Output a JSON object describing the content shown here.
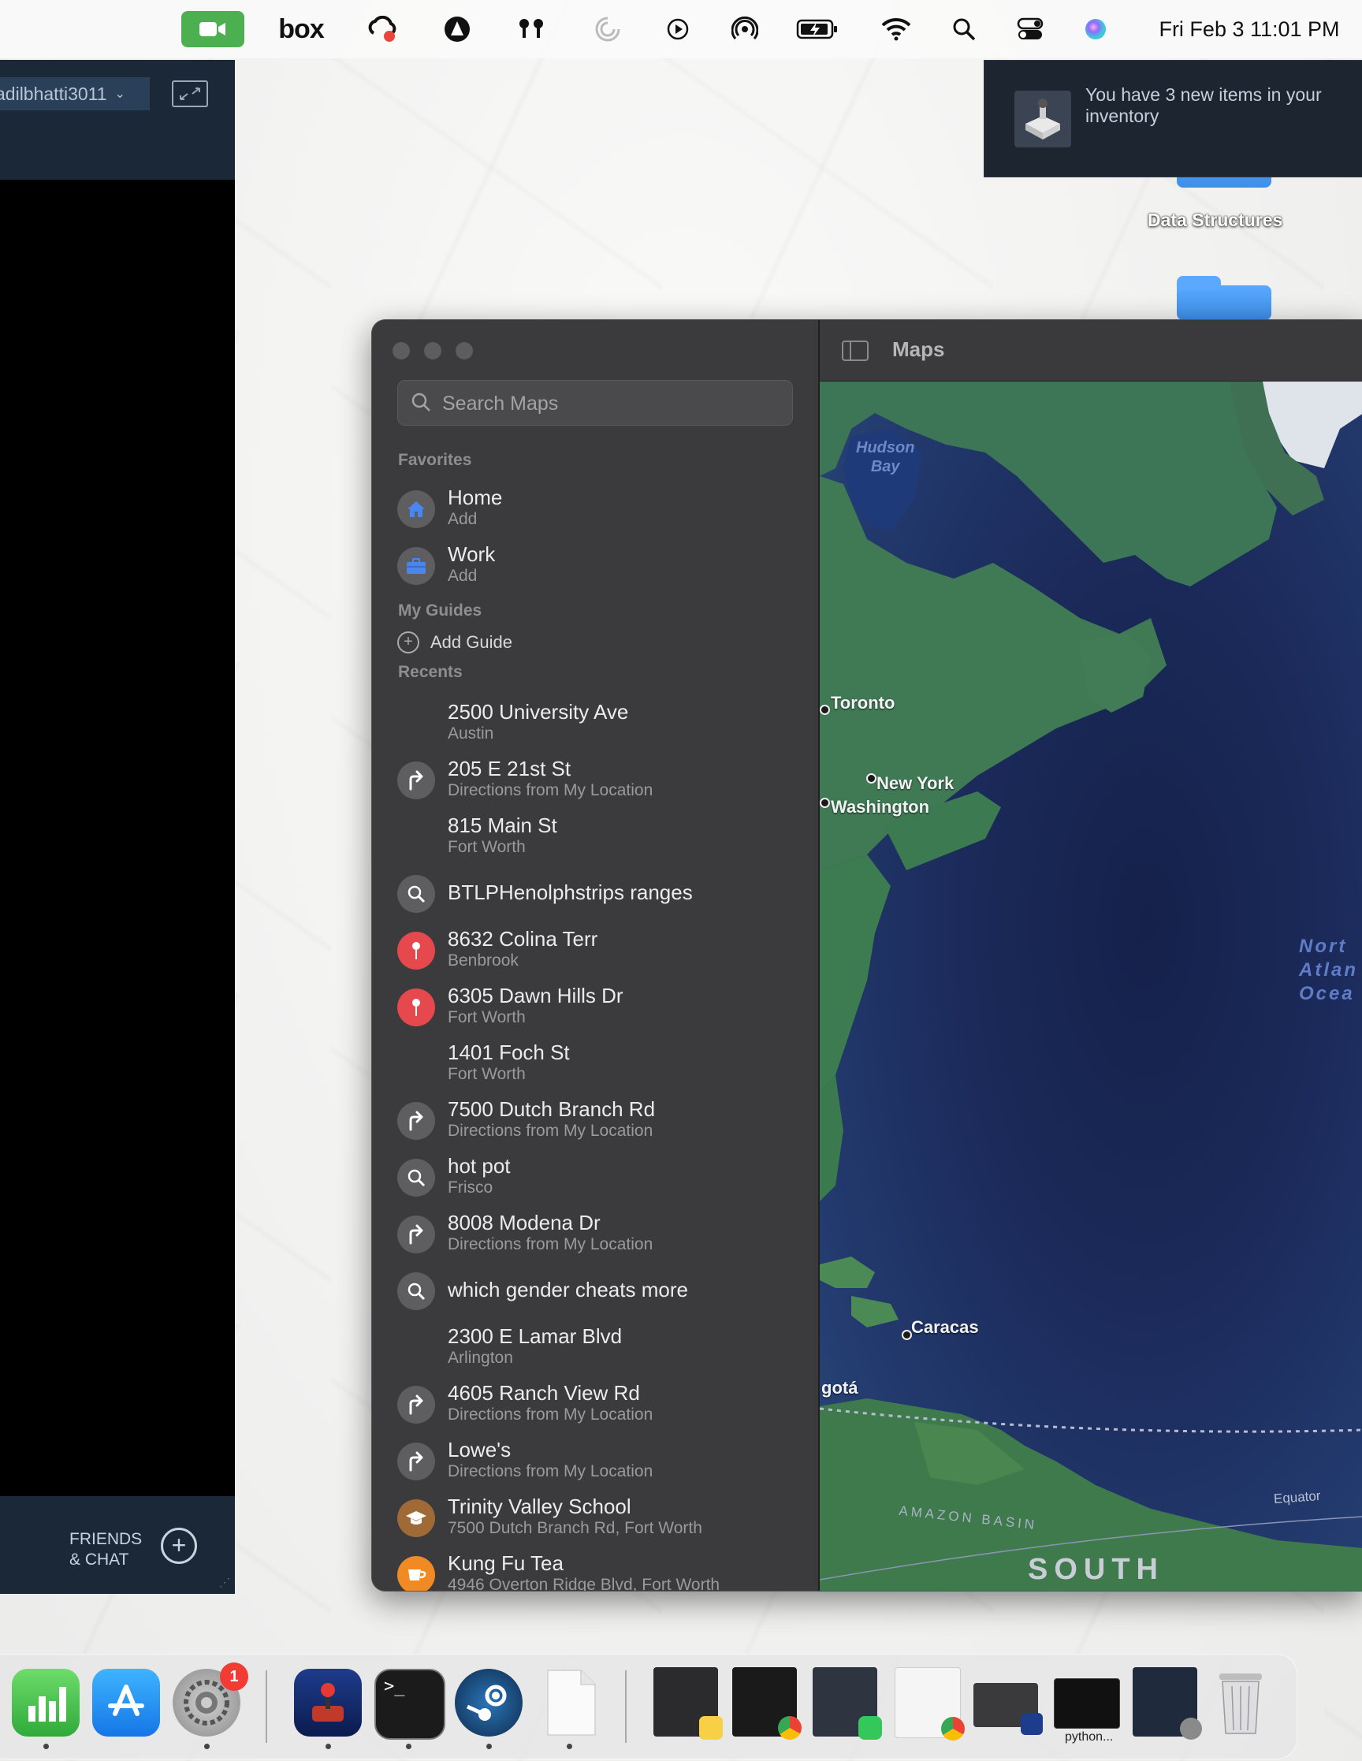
{
  "menubar": {
    "icons": [
      "zoom-video-icon",
      "box-icon",
      "creative-cloud-icon",
      "vpn-icon",
      "airpods-icon",
      "loading-icon",
      "play-icon",
      "airdrop-icon",
      "battery-icon",
      "wifi-icon",
      "spotlight-search-icon",
      "control-center-icon",
      "siri-icon"
    ],
    "box_label": "box",
    "clock": "Fri Feb 3  11:01 PM"
  },
  "steam": {
    "username": "adilbhatti3011",
    "friends_label": "FRIENDS\n& CHAT"
  },
  "desktop": {
    "folders": [
      {
        "label": "Data Structures"
      },
      {
        "label": ""
      }
    ]
  },
  "notification": {
    "text": "You have 3 new items in your inventory"
  },
  "maps": {
    "title": "Maps",
    "search_placeholder": "Search Maps",
    "favorites_header": "Favorites",
    "favorites": [
      {
        "title": "Home",
        "subtitle": "Add",
        "icon": "home-icon"
      },
      {
        "title": "Work",
        "subtitle": "Add",
        "icon": "briefcase-icon"
      }
    ],
    "guides_header": "My Guides",
    "add_guide": "Add Guide",
    "recents_header": "Recents",
    "recents": [
      {
        "title": "2500 University Ave",
        "subtitle": "Austin",
        "icon": "none"
      },
      {
        "title": "205 E 21st St",
        "subtitle": "Directions from My Location",
        "icon": "directions"
      },
      {
        "title": "815 Main St",
        "subtitle": "Fort Worth",
        "icon": "none"
      },
      {
        "title": "BTLPHenolphstrips ranges",
        "subtitle": "",
        "icon": "search"
      },
      {
        "title": "8632 Colina Terr",
        "subtitle": "Benbrook",
        "icon": "pin"
      },
      {
        "title": "6305 Dawn Hills Dr",
        "subtitle": "Fort Worth",
        "icon": "pin"
      },
      {
        "title": "1401 Foch St",
        "subtitle": "Fort Worth",
        "icon": "none"
      },
      {
        "title": "7500 Dutch Branch Rd",
        "subtitle": "Directions from My Location",
        "icon": "directions"
      },
      {
        "title": "hot pot",
        "subtitle": "Frisco",
        "icon": "search"
      },
      {
        "title": "8008 Modena Dr",
        "subtitle": "Directions from My Location",
        "icon": "directions"
      },
      {
        "title": "which gender cheats more",
        "subtitle": "",
        "icon": "search"
      },
      {
        "title": "2300 E Lamar Blvd",
        "subtitle": "Arlington",
        "icon": "none"
      },
      {
        "title": "4605 Ranch View Rd",
        "subtitle": "Directions from My Location",
        "icon": "directions"
      },
      {
        "title": "Lowe's",
        "subtitle": "Directions from My Location",
        "icon": "directions"
      },
      {
        "title": "Trinity Valley School",
        "subtitle": "7500 Dutch Branch Rd, Fort Worth",
        "icon": "school"
      },
      {
        "title": "Kung Fu Tea",
        "subtitle": "4946 Overton Ridge Blvd, Fort Worth",
        "icon": "cafe"
      }
    ],
    "map_labels": {
      "hudson_bay": "Hudson\nBay",
      "toronto": "Toronto",
      "new_york": "New York",
      "washington": "Washington",
      "north_atlantic": "Nort\nAtlan\nOcea",
      "caracas": "Caracas",
      "bogota": "gotá",
      "amazon_basin": "AMAZON BASIN",
      "equator": "Equator",
      "south": "SOUTH"
    }
  },
  "dock": {
    "apps": [
      "numbers-icon",
      "app-store-icon",
      "system-settings-icon",
      "joystick-app-icon",
      "terminal-icon",
      "steam-icon",
      "blank-document-icon"
    ],
    "settings_badge": "1",
    "terminal_glyph": ">_",
    "windows": [
      "window-thumb-1",
      "window-thumb-2",
      "window-thumb-3",
      "window-thumb-4",
      "window-thumb-5",
      "python-window-thumb",
      "window-thumb-7"
    ],
    "python_label": "python...",
    "trash": "trash-icon"
  },
  "colors": {
    "map_land": "#3f7a55",
    "map_water": "#1b2a5a",
    "steam_dark": "#1b2838",
    "accent_red": "#e5484d"
  }
}
